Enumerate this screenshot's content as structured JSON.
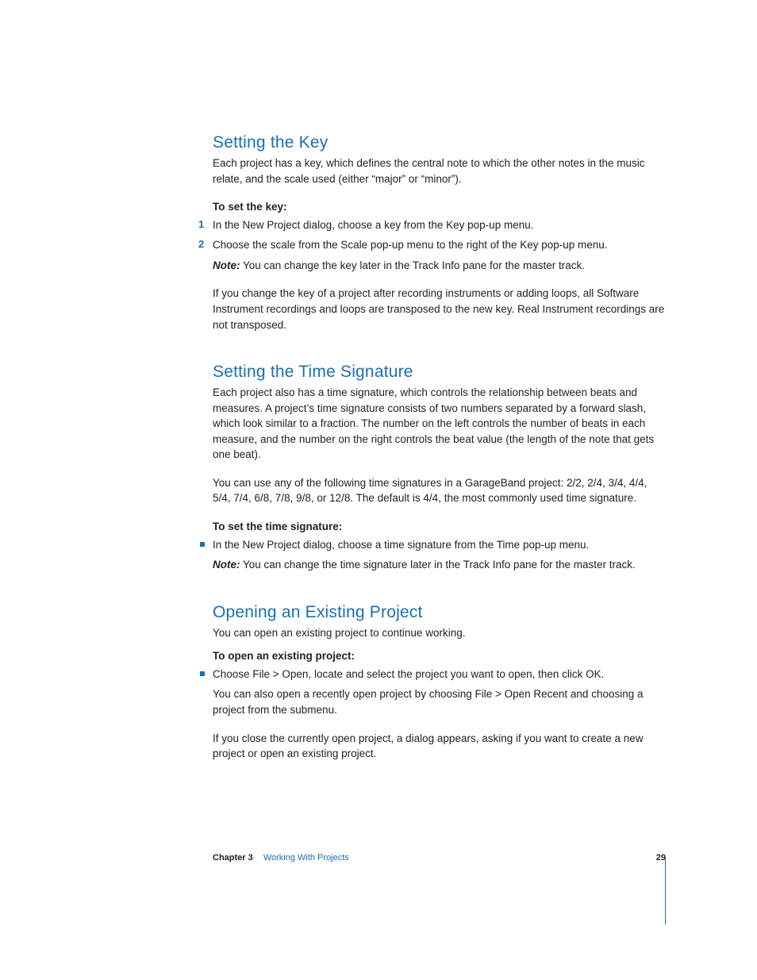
{
  "section1": {
    "heading": "Setting the Key",
    "intro": "Each project has a key, which defines the central note to which the other notes in the music relate, and the scale used (either “major” or “minor”).",
    "lead": "To set the key:",
    "steps": [
      {
        "num": "1",
        "text": "In the New Project dialog, choose a key from the Key pop-up menu."
      },
      {
        "num": "2",
        "text": "Choose the scale from the Scale pop-up menu to the right of the Key pop-up menu."
      }
    ],
    "note_label": "Note:",
    "note_text": "  You can change the key later in the Track Info pane for the master track.",
    "para2": "If you change the key of a project after recording instruments or adding loops, all Software Instrument recordings and loops are transposed to the new key. Real Instrument recordings are not transposed."
  },
  "section2": {
    "heading": "Setting the Time Signature",
    "intro": "Each project also has a time signature, which controls the relationship between beats and measures. A project’s time signature consists of two numbers separated by a forward slash, which look similar to a fraction. The number on the left controls the number of beats in each measure, and the number on the right controls the beat value (the length of the note that gets one beat).",
    "para2": "You can use any of the following time signatures in a GarageBand project: 2/2, 2/4, 3/4, 4/4, 5/4, 7/4, 6/8, 7/8, 9/8, or 12/8. The default is 4/4, the most commonly used time signature.",
    "lead": "To set the time signature:",
    "bullets": [
      {
        "text": "In the New Project dialog, choose a time signature from the Time pop-up menu."
      }
    ],
    "note_label": "Note:",
    "note_text": "  You can change the time signature later in the Track Info pane for the master track."
  },
  "section3": {
    "heading": "Opening an Existing Project",
    "intro": "You can open an existing project to continue working.",
    "lead": "To open an existing project:",
    "bullets": [
      {
        "text": "Choose File > Open, locate and select the project you want to open, then click OK."
      }
    ],
    "para2": "You can also open a recently open project by choosing File > Open Recent and choosing a project from the submenu.",
    "para3": "If you close the currently open project, a dialog appears, asking if you want to create a new project or open an existing project."
  },
  "footer": {
    "chapter_label": "Chapter 3",
    "chapter_title": "Working With Projects",
    "page_number": "29"
  }
}
